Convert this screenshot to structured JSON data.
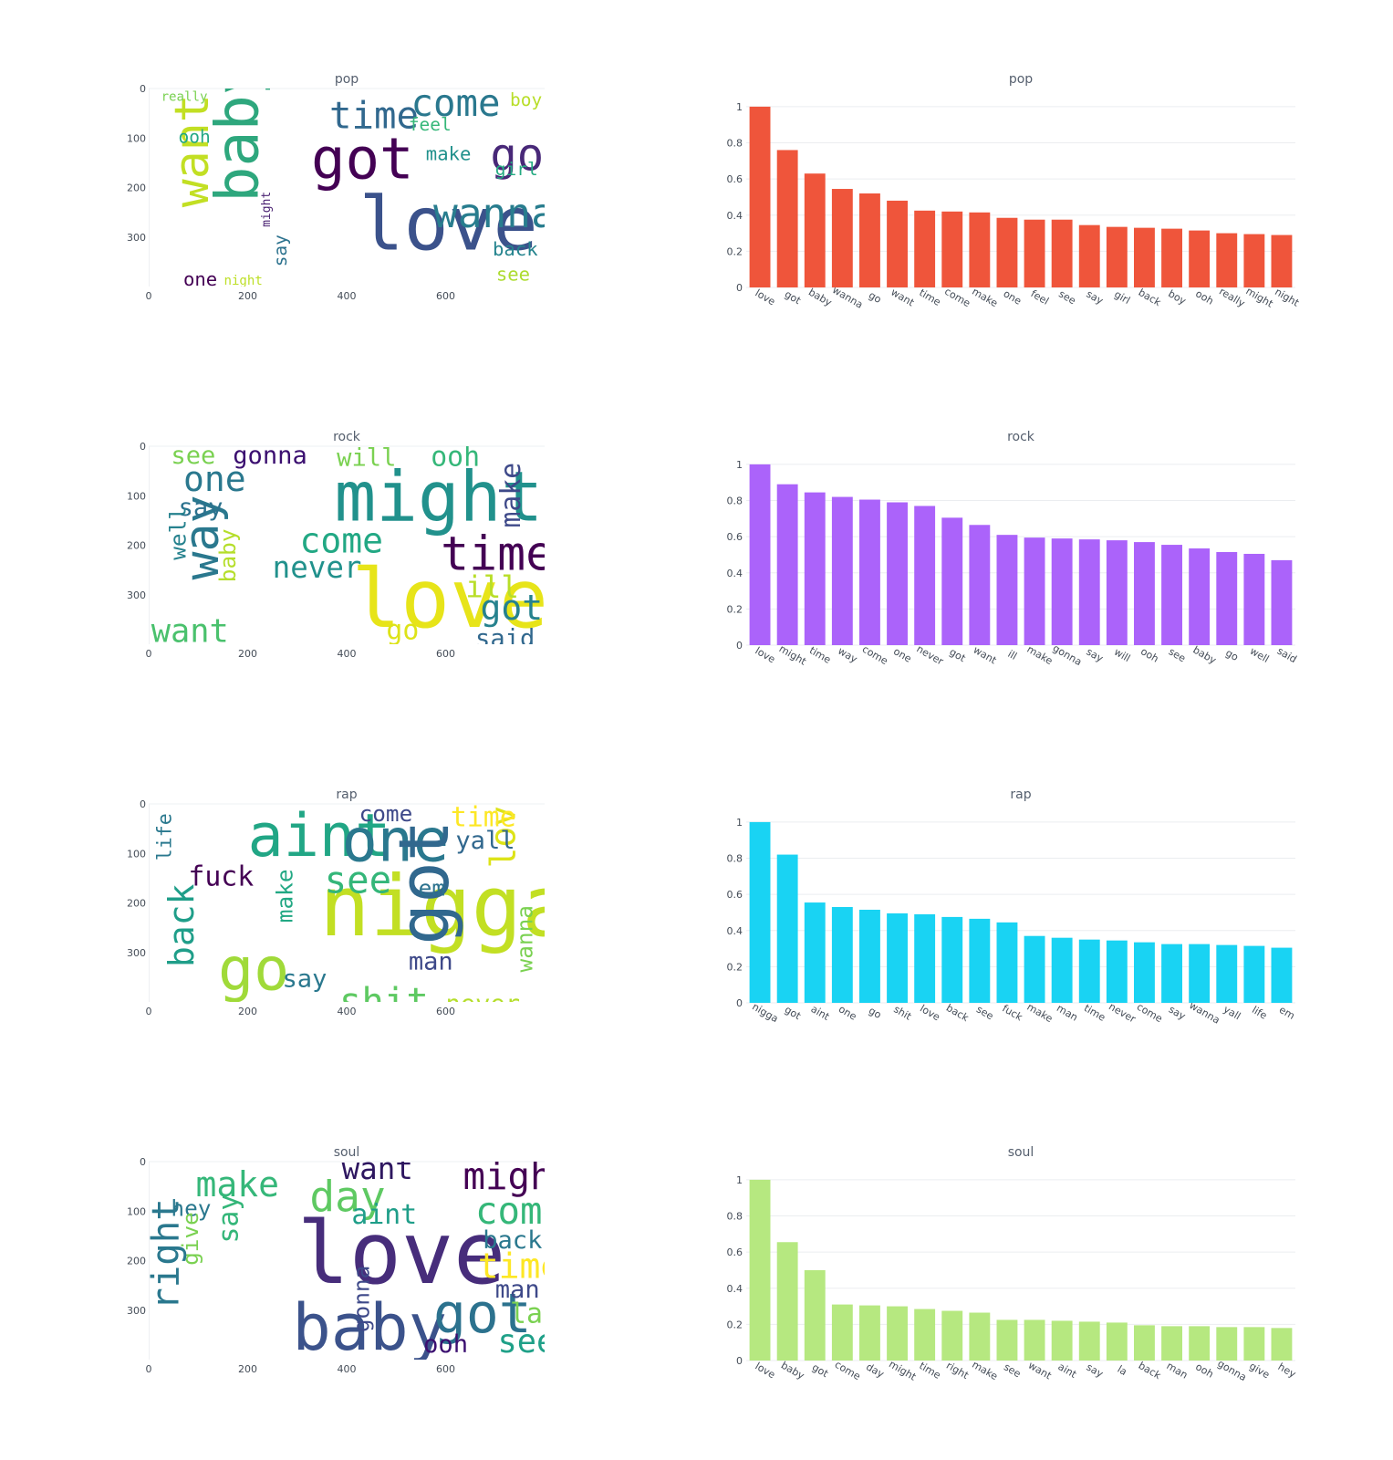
{
  "chart_data": [
    {
      "type": "wordcloud",
      "title": "pop",
      "xlim": [
        0,
        800
      ],
      "ylim": [
        0,
        400
      ],
      "xticks": [
        "0",
        "200",
        "400",
        "600"
      ],
      "yticks": [
        "0",
        "100",
        "200",
        "300"
      ],
      "words": [
        {
          "text": "love",
          "x": 425,
          "y": 325,
          "size": 150,
          "rotate": false,
          "color": "#3b528b"
        },
        {
          "text": "got",
          "x": 328,
          "y": 182,
          "size": 115,
          "rotate": false,
          "color": "#440154"
        },
        {
          "text": "wanna",
          "x": 575,
          "y": 280,
          "size": 82,
          "rotate": false,
          "color": "#287d8e"
        },
        {
          "text": "baby",
          "x": 220,
          "y": 230,
          "size": 120,
          "rotate": true,
          "color": "#2ea77d"
        },
        {
          "text": "want",
          "x": 120,
          "y": 240,
          "size": 95,
          "rotate": true,
          "color": "#c2df23"
        },
        {
          "text": "time",
          "x": 365,
          "y": 80,
          "size": 75,
          "rotate": false,
          "color": "#31688e"
        },
        {
          "text": "come",
          "x": 530,
          "y": 55,
          "size": 75,
          "rotate": false,
          "color": "#2a788e"
        },
        {
          "text": "go",
          "x": 690,
          "y": 165,
          "size": 90,
          "rotate": false,
          "color": "#482878"
        },
        {
          "text": "feel",
          "x": 525,
          "y": 85,
          "size": 36,
          "rotate": false,
          "color": "#35b779"
        },
        {
          "text": "make",
          "x": 560,
          "y": 145,
          "size": 38,
          "rotate": false,
          "color": "#21918c"
        },
        {
          "text": "girl",
          "x": 700,
          "y": 175,
          "size": 36,
          "rotate": false,
          "color": "#25ab82"
        },
        {
          "text": "boy",
          "x": 730,
          "y": 35,
          "size": 36,
          "rotate": false,
          "color": "#b8de29"
        },
        {
          "text": "really",
          "x": 25,
          "y": 25,
          "size": 26,
          "rotate": false,
          "color": "#7ad151"
        },
        {
          "text": "ooh",
          "x": 60,
          "y": 110,
          "size": 36,
          "rotate": false,
          "color": "#22a884"
        },
        {
          "text": "might",
          "x": 245,
          "y": 280,
          "size": 24,
          "rotate": true,
          "color": "#481f70"
        },
        {
          "text": "say",
          "x": 278,
          "y": 360,
          "size": 36,
          "rotate": true,
          "color": "#2c728e"
        },
        {
          "text": "back",
          "x": 695,
          "y": 337,
          "size": 38,
          "rotate": false,
          "color": "#25848e"
        },
        {
          "text": "see",
          "x": 702,
          "y": 388,
          "size": 38,
          "rotate": false,
          "color": "#addc30"
        },
        {
          "text": "one",
          "x": 70,
          "y": 398,
          "size": 38,
          "rotate": false,
          "color": "#440154"
        },
        {
          "text": "night",
          "x": 152,
          "y": 396,
          "size": 26,
          "rotate": false,
          "color": "#bddf26"
        }
      ]
    },
    {
      "type": "bar",
      "title": "pop",
      "color": "#ef553b",
      "categories": [
        "love",
        "got",
        "baby",
        "wanna",
        "go",
        "want",
        "time",
        "come",
        "make",
        "one",
        "feel",
        "see",
        "say",
        "girl",
        "back",
        "boy",
        "ooh",
        "really",
        "might",
        "night"
      ],
      "values": [
        1.0,
        0.76,
        0.63,
        0.545,
        0.52,
        0.48,
        0.425,
        0.42,
        0.415,
        0.385,
        0.375,
        0.375,
        0.345,
        0.335,
        0.33,
        0.325,
        0.315,
        0.3,
        0.295,
        0.29
      ],
      "ylim": [
        0,
        1.05
      ],
      "yticks": [
        "0",
        "0.2",
        "0.4",
        "0.6",
        "0.8",
        "1"
      ]
    },
    {
      "type": "wordcloud",
      "title": "rock",
      "xlim": [
        0,
        800
      ],
      "ylim": [
        0,
        400
      ],
      "xticks": [
        "0",
        "200",
        "400",
        "600"
      ],
      "yticks": [
        "0",
        "100",
        "200",
        "300"
      ],
      "words": [
        {
          "text": "love",
          "x": 410,
          "y": 365,
          "size": 165,
          "rotate": false,
          "color": "#e7e419"
        },
        {
          "text": "might",
          "x": 375,
          "y": 150,
          "size": 140,
          "rotate": false,
          "color": "#21918c"
        },
        {
          "text": "time",
          "x": 590,
          "y": 250,
          "size": 95,
          "rotate": false,
          "color": "#440154"
        },
        {
          "text": "way",
          "x": 140,
          "y": 270,
          "size": 95,
          "rotate": true,
          "color": "#2a788e"
        },
        {
          "text": "come",
          "x": 305,
          "y": 215,
          "size": 70,
          "rotate": false,
          "color": "#22a884"
        },
        {
          "text": "one",
          "x": 70,
          "y": 90,
          "size": 70,
          "rotate": false,
          "color": "#2a788e"
        },
        {
          "text": "never",
          "x": 250,
          "y": 265,
          "size": 60,
          "rotate": false,
          "color": "#21918c"
        },
        {
          "text": "will",
          "x": 380,
          "y": 40,
          "size": 50,
          "rotate": false,
          "color": "#7ad151"
        },
        {
          "text": "ooh",
          "x": 570,
          "y": 40,
          "size": 55,
          "rotate": false,
          "color": "#35b779"
        },
        {
          "text": "make",
          "x": 750,
          "y": 165,
          "size": 55,
          "rotate": true,
          "color": "#3e4989"
        },
        {
          "text": "gonna",
          "x": 170,
          "y": 35,
          "size": 50,
          "rotate": false,
          "color": "#3b0f70"
        },
        {
          "text": "see",
          "x": 45,
          "y": 35,
          "size": 50,
          "rotate": false,
          "color": "#7ad151"
        },
        {
          "text": "say",
          "x": 60,
          "y": 140,
          "size": 50,
          "rotate": false,
          "color": "#2c728e"
        },
        {
          "text": "well",
          "x": 75,
          "y": 230,
          "size": 45,
          "rotate": true,
          "color": "#26828e"
        },
        {
          "text": "baby",
          "x": 175,
          "y": 275,
          "size": 45,
          "rotate": true,
          "color": "#b5de2b"
        },
        {
          "text": "ill",
          "x": 640,
          "y": 305,
          "size": 60,
          "rotate": false,
          "color": "#b8de29"
        },
        {
          "text": "got",
          "x": 670,
          "y": 350,
          "size": 70,
          "rotate": false,
          "color": "#26828e"
        },
        {
          "text": "want",
          "x": 5,
          "y": 395,
          "size": 65,
          "rotate": false,
          "color": "#4ac16d"
        },
        {
          "text": "go",
          "x": 480,
          "y": 390,
          "size": 55,
          "rotate": false,
          "color": "#dde318"
        },
        {
          "text": "said",
          "x": 660,
          "y": 405,
          "size": 50,
          "rotate": false,
          "color": "#31688e"
        }
      ]
    },
    {
      "type": "bar",
      "title": "rock",
      "color": "#ab63fa",
      "categories": [
        "love",
        "might",
        "time",
        "way",
        "come",
        "one",
        "never",
        "got",
        "want",
        "ill",
        "make",
        "gonna",
        "say",
        "will",
        "ooh",
        "see",
        "baby",
        "go",
        "well",
        "said"
      ],
      "values": [
        1.0,
        0.89,
        0.845,
        0.82,
        0.805,
        0.79,
        0.77,
        0.705,
        0.665,
        0.61,
        0.595,
        0.59,
        0.585,
        0.58,
        0.57,
        0.555,
        0.535,
        0.515,
        0.505,
        0.47
      ],
      "ylim": [
        0,
        1.05
      ],
      "yticks": [
        "0",
        "0.2",
        "0.4",
        "0.6",
        "0.8",
        "1"
      ]
    },
    {
      "type": "wordcloud",
      "title": "rap",
      "xlim": [
        0,
        800
      ],
      "ylim": [
        0,
        400
      ],
      "xticks": [
        "0",
        "200",
        "400",
        "600"
      ],
      "yticks": [
        "0",
        "100",
        "200",
        "300"
      ],
      "words": [
        {
          "text": "nigga",
          "x": 345,
          "y": 265,
          "size": 170,
          "rotate": false,
          "color": "#c2df23"
        },
        {
          "text": "aint",
          "x": 200,
          "y": 105,
          "size": 120,
          "rotate": false,
          "color": "#21a685"
        },
        {
          "text": "one",
          "x": 390,
          "y": 115,
          "size": 120,
          "rotate": false,
          "color": "#2a788e"
        },
        {
          "text": "got",
          "x": 605,
          "y": 285,
          "size": 140,
          "rotate": true,
          "color": "#31688e"
        },
        {
          "text": "love",
          "x": 740,
          "y": 130,
          "size": 70,
          "rotate": true,
          "color": "#dde318"
        },
        {
          "text": "go",
          "x": 140,
          "y": 375,
          "size": 120,
          "rotate": false,
          "color": "#a0da39"
        },
        {
          "text": "back",
          "x": 90,
          "y": 330,
          "size": 70,
          "rotate": true,
          "color": "#1f9e89"
        },
        {
          "text": "see",
          "x": 355,
          "y": 180,
          "size": 75,
          "rotate": false,
          "color": "#34b679"
        },
        {
          "text": "fuck",
          "x": 80,
          "y": 165,
          "size": 55,
          "rotate": false,
          "color": "#440154"
        },
        {
          "text": "make",
          "x": 290,
          "y": 240,
          "size": 45,
          "rotate": true,
          "color": "#22a884"
        },
        {
          "text": "shit",
          "x": 385,
          "y": 425,
          "size": 75,
          "rotate": false,
          "color": "#5ec962"
        },
        {
          "text": "come",
          "x": 425,
          "y": 35,
          "size": 45,
          "rotate": false,
          "color": "#3e4989"
        },
        {
          "text": "time",
          "x": 610,
          "y": 45,
          "size": 55,
          "rotate": false,
          "color": "#fde725"
        },
        {
          "text": "yall",
          "x": 620,
          "y": 90,
          "size": 50,
          "rotate": false,
          "color": "#31688e"
        },
        {
          "text": "em",
          "x": 545,
          "y": 185,
          "size": 45,
          "rotate": false,
          "color": "#2c728e"
        },
        {
          "text": "life",
          "x": 45,
          "y": 115,
          "size": 40,
          "rotate": true,
          "color": "#2a788e"
        },
        {
          "text": "man",
          "x": 525,
          "y": 335,
          "size": 50,
          "rotate": false,
          "color": "#3e4989"
        },
        {
          "text": "say",
          "x": 270,
          "y": 370,
          "size": 50,
          "rotate": false,
          "color": "#2a788e"
        },
        {
          "text": "never",
          "x": 600,
          "y": 420,
          "size": 50,
          "rotate": false,
          "color": "#b5de2b"
        },
        {
          "text": "wanna",
          "x": 775,
          "y": 340,
          "size": 45,
          "rotate": true,
          "color": "#7ad151"
        }
      ]
    },
    {
      "type": "bar",
      "title": "rap",
      "color": "#19d3f3",
      "categories": [
        "nigga",
        "got",
        "aint",
        "one",
        "go",
        "shit",
        "love",
        "back",
        "see",
        "fuck",
        "make",
        "man",
        "time",
        "never",
        "come",
        "say",
        "wanna",
        "yall",
        "life",
        "em"
      ],
      "values": [
        1.0,
        0.82,
        0.555,
        0.53,
        0.515,
        0.495,
        0.49,
        0.475,
        0.465,
        0.445,
        0.37,
        0.36,
        0.35,
        0.345,
        0.335,
        0.325,
        0.325,
        0.32,
        0.315,
        0.305
      ],
      "ylim": [
        0,
        1.05
      ],
      "yticks": [
        "0",
        "0.2",
        "0.4",
        "0.6",
        "0.8",
        "1"
      ]
    },
    {
      "type": "wordcloud",
      "title": "soul",
      "xlim": [
        0,
        800
      ],
      "ylim": [
        0,
        400
      ],
      "xticks": [
        "0",
        "200",
        "400",
        "600"
      ],
      "yticks": [
        "0",
        "100",
        "200",
        "300"
      ],
      "words": [
        {
          "text": "love",
          "x": 300,
          "y": 245,
          "size": 175,
          "rotate": false,
          "color": "#472d7b"
        },
        {
          "text": "baby",
          "x": 290,
          "y": 380,
          "size": 130,
          "rotate": false,
          "color": "#3b528b"
        },
        {
          "text": "got",
          "x": 575,
          "y": 345,
          "size": 110,
          "rotate": false,
          "color": "#2c728e"
        },
        {
          "text": "might",
          "x": 635,
          "y": 55,
          "size": 75,
          "rotate": false,
          "color": "#440154"
        },
        {
          "text": "come",
          "x": 660,
          "y": 125,
          "size": 75,
          "rotate": false,
          "color": "#35b779"
        },
        {
          "text": "day",
          "x": 325,
          "y": 100,
          "size": 85,
          "rotate": false,
          "color": "#5ec962"
        },
        {
          "text": "make",
          "x": 95,
          "y": 70,
          "size": 70,
          "rotate": false,
          "color": "#35b779"
        },
        {
          "text": "want",
          "x": 390,
          "y": 35,
          "size": 60,
          "rotate": false,
          "color": "#2e1760"
        },
        {
          "text": "aint",
          "x": 410,
          "y": 125,
          "size": 55,
          "rotate": false,
          "color": "#1f9e89"
        },
        {
          "text": "back",
          "x": 675,
          "y": 175,
          "size": 50,
          "rotate": false,
          "color": "#2a788e"
        },
        {
          "text": "time",
          "x": 665,
          "y": 235,
          "size": 70,
          "rotate": false,
          "color": "#fde725"
        },
        {
          "text": "man",
          "x": 700,
          "y": 275,
          "size": 50,
          "rotate": false,
          "color": "#3e4989"
        },
        {
          "text": "la",
          "x": 730,
          "y": 325,
          "size": 55,
          "rotate": false,
          "color": "#7ad151"
        },
        {
          "text": "see",
          "x": 705,
          "y": 385,
          "size": 65,
          "rotate": false,
          "color": "#1fa088"
        },
        {
          "text": "ooh",
          "x": 555,
          "y": 385,
          "size": 50,
          "rotate": false,
          "color": "#3b0f70"
        },
        {
          "text": "hey",
          "x": 45,
          "y": 110,
          "size": 45,
          "rotate": false,
          "color": "#2a788e"
        },
        {
          "text": "give",
          "x": 100,
          "y": 210,
          "size": 45,
          "rotate": true,
          "color": "#7ad151"
        },
        {
          "text": "say",
          "x": 180,
          "y": 165,
          "size": 55,
          "rotate": true,
          "color": "#34b679"
        },
        {
          "text": "right",
          "x": 60,
          "y": 300,
          "size": 75,
          "rotate": true,
          "color": "#2a788e"
        },
        {
          "text": "gonna",
          "x": 445,
          "y": 345,
          "size": 45,
          "rotate": true,
          "color": "#3e4989"
        }
      ]
    },
    {
      "type": "bar",
      "title": "soul",
      "color": "#b6e880",
      "categories": [
        "love",
        "baby",
        "got",
        "come",
        "day",
        "might",
        "time",
        "right",
        "make",
        "see",
        "want",
        "aint",
        "say",
        "la",
        "back",
        "man",
        "ooh",
        "gonna",
        "give",
        "hey"
      ],
      "values": [
        1.0,
        0.655,
        0.5,
        0.31,
        0.305,
        0.3,
        0.285,
        0.275,
        0.265,
        0.225,
        0.225,
        0.22,
        0.215,
        0.21,
        0.195,
        0.19,
        0.19,
        0.185,
        0.185,
        0.18
      ],
      "ylim": [
        0,
        1.05
      ],
      "yticks": [
        "0",
        "0.2",
        "0.4",
        "0.6",
        "0.8",
        "1"
      ]
    }
  ]
}
